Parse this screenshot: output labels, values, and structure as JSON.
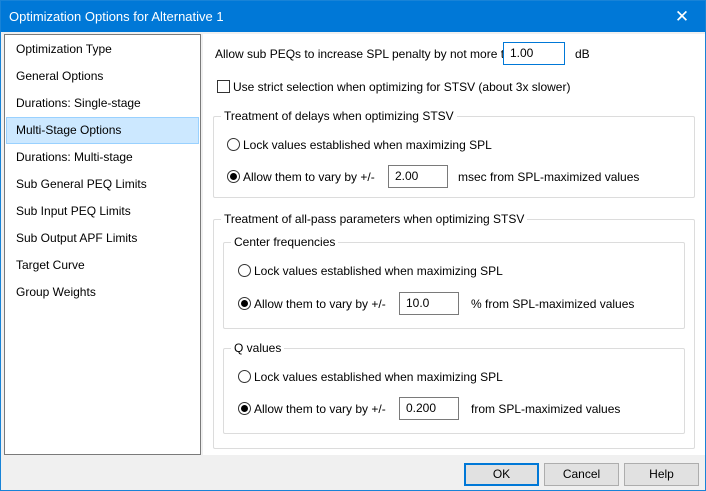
{
  "window": {
    "title": "Optimization Options for Alternative 1",
    "close_glyph": "✕"
  },
  "sidebar": {
    "items": [
      {
        "label": "Optimization Type"
      },
      {
        "label": "General Options"
      },
      {
        "label": "Durations: Single-stage"
      },
      {
        "label": "Multi-Stage Options",
        "selected": true
      },
      {
        "label": "Durations: Multi-stage"
      },
      {
        "label": "Sub General PEQ Limits"
      },
      {
        "label": "Sub Input PEQ Limits"
      },
      {
        "label": "Sub Output APF Limits"
      },
      {
        "label": "Target Curve"
      },
      {
        "label": "Group Weights"
      }
    ]
  },
  "main": {
    "spl_penalty": {
      "label": "Allow sub PEQs to increase SPL penalty by not more than",
      "value": "1.00",
      "unit": "dB"
    },
    "strict_selection": {
      "label": "Use strict selection when optimizing for STSV (about 3x slower)",
      "checked": false
    },
    "delays": {
      "title": "Treatment of delays when optimizing STSV",
      "lock_label": "Lock values established when maximizing SPL",
      "vary_label": "Allow them to vary by +/-",
      "value": "2.00",
      "suffix": "msec from SPL-maximized values",
      "selected": "vary"
    },
    "allpass": {
      "title": "Treatment of all-pass parameters when optimizing STSV",
      "center": {
        "title": "Center frequencies",
        "lock_label": "Lock values established when maximizing SPL",
        "vary_label": "Allow them to vary by +/-",
        "value": "10.0",
        "suffix": "% from SPL-maximized values",
        "selected": "vary"
      },
      "q": {
        "title": "Q values",
        "lock_label": "Lock values established when maximizing SPL",
        "vary_label": "Allow them to vary by +/-",
        "value": "0.200",
        "suffix": "from SPL-maximized values",
        "selected": "vary"
      }
    }
  },
  "footer": {
    "ok_label": "OK",
    "cancel_label": "Cancel",
    "help_label": "Help"
  }
}
